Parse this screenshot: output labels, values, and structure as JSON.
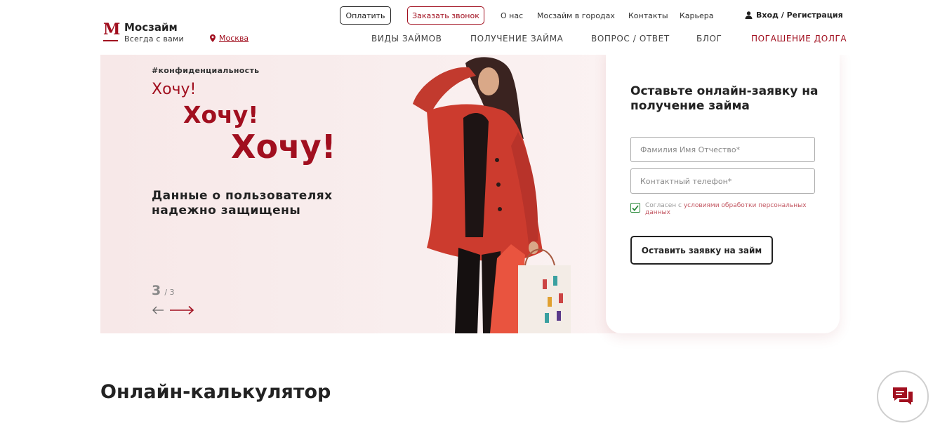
{
  "brand": {
    "name": "Мосзайм",
    "tagline": "Всегда с вами",
    "logo_letter": "M",
    "accent_color": "#a10f1f"
  },
  "header": {
    "city": "Москва",
    "pay_button": "Оплатить",
    "call_button": "Заказать звонок",
    "top_links": [
      "О нас",
      "Мосзайм в городах",
      "Контакты",
      "Карьера"
    ],
    "login": "Вход / Регистрация",
    "main_nav": [
      "ВИДЫ ЗАЙМОВ",
      "ПОЛУЧЕНИЕ ЗАЙМА",
      "ВОПРОС / ОТВЕТ",
      "БЛОГ",
      "ПОГАШЕНИЕ ДОЛГА"
    ]
  },
  "banner": {
    "hashtag": "#конфиденциальность",
    "want": [
      "Хочу!",
      "Хочу!",
      "Хочу!"
    ],
    "slogan": "Данные о пользователях надежно защищены",
    "slide_current": "3",
    "slide_total": "/ 3"
  },
  "form": {
    "title": "Оставьте онлайн-заявку на получение займа",
    "name_placeholder": "Фамилия Имя Отчество*",
    "phone_placeholder": "Контактный телефон*",
    "agree_prefix": "Согласен с ",
    "agree_link": "условиями обработки персональных данных",
    "checked": true,
    "submit": "Оставить заявку на займ"
  },
  "calculator": {
    "title": "Онлайн-калькулятор"
  },
  "icons": [
    "location-pin-icon",
    "user-icon",
    "arrow-left-icon",
    "arrow-right-icon",
    "chat-icon",
    "checkmark-icon"
  ]
}
